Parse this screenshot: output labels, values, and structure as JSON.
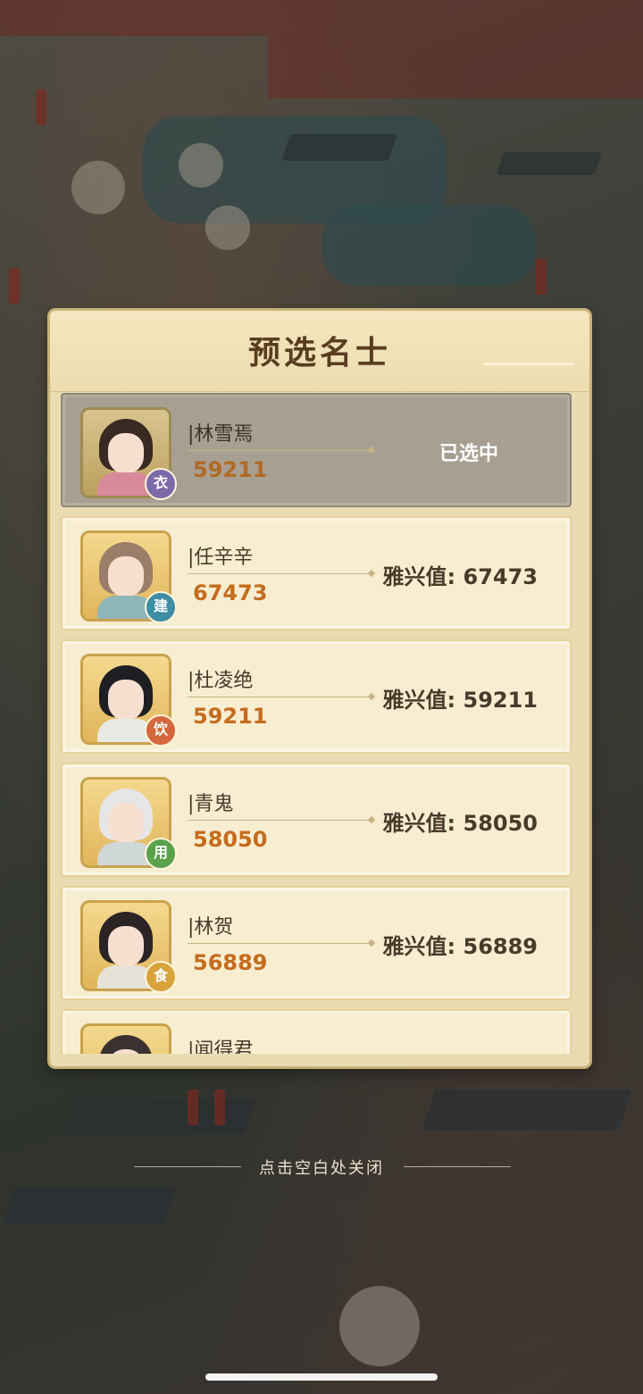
{
  "dialog": {
    "title": "预选名士",
    "value_prefix": "雅兴值: "
  },
  "candidates": [
    {
      "name": "|林雪焉",
      "score": "59211",
      "badge": "衣",
      "badge_color": "#7d6aa8",
      "status": "已选中",
      "selected": true,
      "value": ""
    },
    {
      "name": "|任辛辛",
      "score": "67473",
      "badge": "建",
      "badge_color": "#3d8da3",
      "status": "",
      "selected": false,
      "value": "雅兴值: 67473"
    },
    {
      "name": "|杜凌绝",
      "score": "59211",
      "badge": "饮",
      "badge_color": "#d4673b",
      "status": "",
      "selected": false,
      "value": "雅兴值: 59211"
    },
    {
      "name": "|青鬼",
      "score": "58050",
      "badge": "用",
      "badge_color": "#5aa24b",
      "status": "",
      "selected": false,
      "value": "雅兴值: 58050"
    },
    {
      "name": "|林贺",
      "score": "56889",
      "badge": "食",
      "badge_color": "#d7a33a",
      "status": "",
      "selected": false,
      "value": "雅兴值: 56889"
    },
    {
      "name": "|闻得君",
      "score": "",
      "badge": "",
      "badge_color": "#cfa650",
      "status": "",
      "selected": false,
      "value": ""
    }
  ],
  "footer": {
    "close_hint": "点击空白处关闭"
  },
  "colors": {
    "accent": "#c56c1d",
    "panel_bg": "#e9dbb2",
    "selected_row": "#a7a092"
  }
}
